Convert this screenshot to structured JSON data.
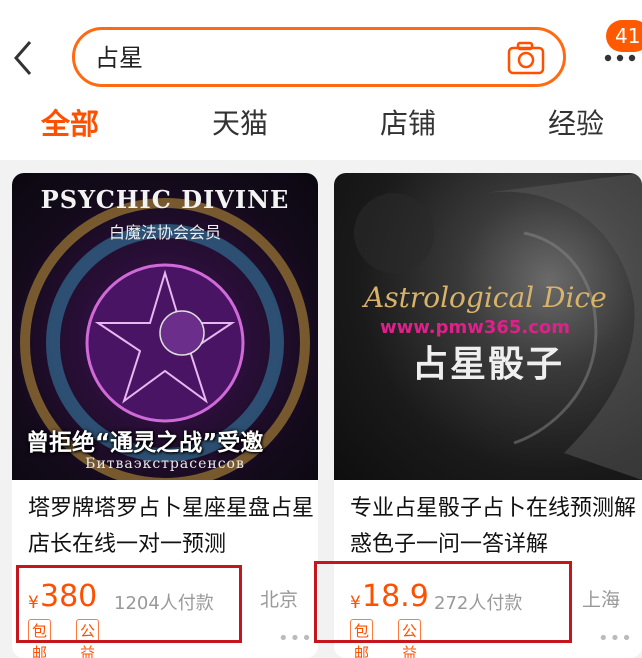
{
  "header": {
    "search_value": "占星",
    "badge": "41"
  },
  "tabs": [
    {
      "label": "全部"
    },
    {
      "label": "天猫"
    },
    {
      "label": "店铺"
    },
    {
      "label": "经验"
    }
  ],
  "products": [
    {
      "image": {
        "heading": "PSYCHIC DIVINE",
        "subheading": "白魔法协会会员",
        "caption": "曾拒绝“通灵之战”受邀",
        "footer": "Битваэкстрасенсов"
      },
      "title": "塔罗牌塔罗占卜星座星盘占星店长在线一对一预测",
      "currency": "¥",
      "price": "380",
      "sold": "1204人付款",
      "location": "北京",
      "tags": [
        "包邮",
        "公益"
      ]
    },
    {
      "image": {
        "heading": "Astrological Dice",
        "watermark": "www.pmw365.com",
        "subheading": "占星骰子"
      },
      "title": "专业占星骰子占卜在线预测解惑色子一问一答详解",
      "currency": "¥",
      "price": "18.9",
      "sold": "272人付款",
      "location": "上海",
      "tags": [
        "包邮",
        "公益"
      ]
    }
  ],
  "colors": {
    "accent": "#ff5000",
    "highlight_box": "#c4161c"
  },
  "icons": [
    "back-arrow-icon",
    "camera-icon",
    "more-icon"
  ]
}
